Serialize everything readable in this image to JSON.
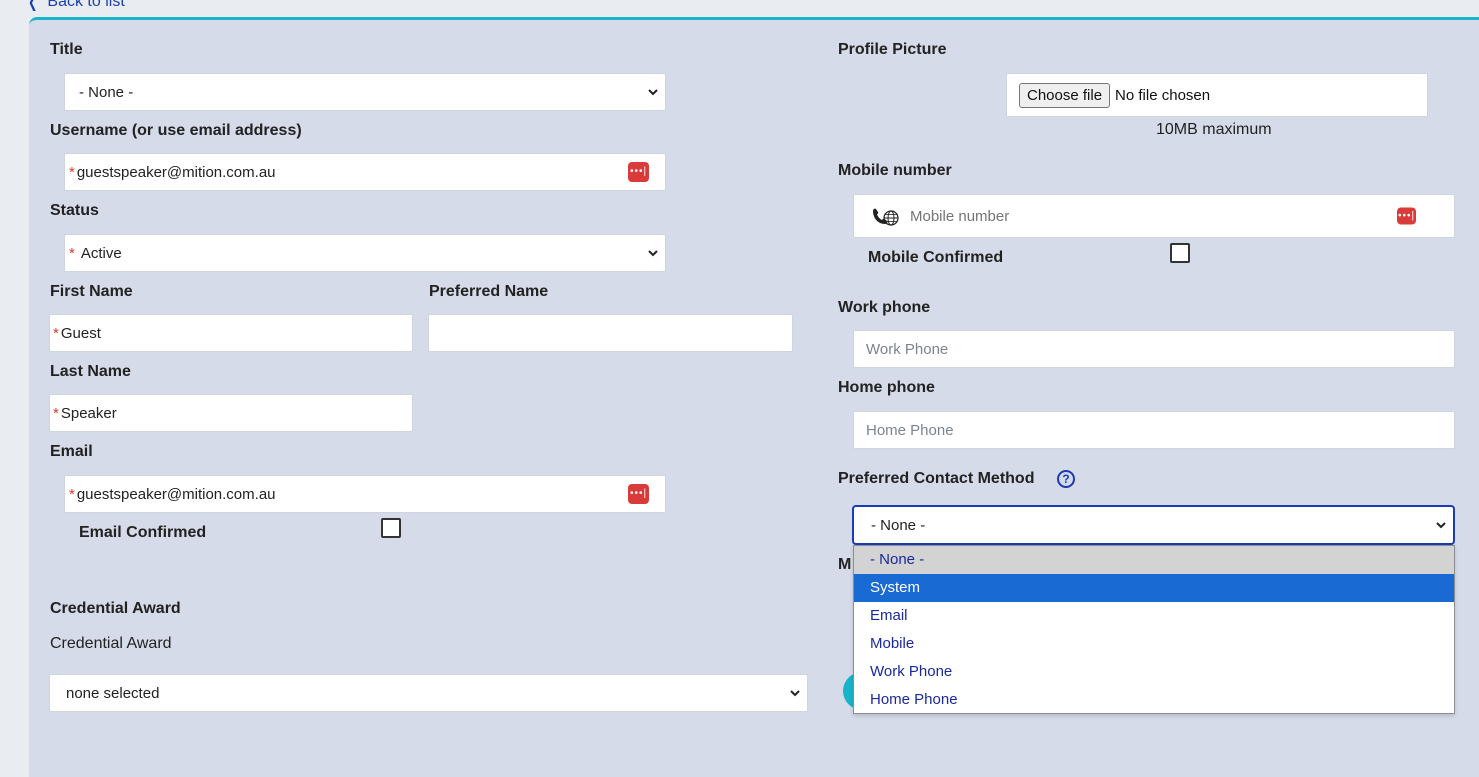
{
  "back_link": "Back to list",
  "left": {
    "title": {
      "label": "Title",
      "value": "- None -"
    },
    "username": {
      "label": "Username (or use email address)",
      "value": "guestspeaker@mition.com.au"
    },
    "status": {
      "label": "Status",
      "value": "Active"
    },
    "first_name": {
      "label": "First Name",
      "value": "Guest"
    },
    "preferred_name": {
      "label": "Preferred Name",
      "value": ""
    },
    "last_name": {
      "label": "Last Name",
      "value": "Speaker"
    },
    "email": {
      "label": "Email",
      "value": "guestspeaker@mition.com.au"
    },
    "email_confirmed": {
      "label": "Email Confirmed",
      "checked": false
    },
    "credential_award": {
      "section_label": "Credential Award",
      "label": "Credential Award",
      "value": "none selected"
    }
  },
  "right": {
    "profile_picture": {
      "label": "Profile Picture",
      "button": "Choose file",
      "status": "No file chosen",
      "hint": "10MB maximum"
    },
    "mobile": {
      "label": "Mobile number",
      "placeholder": "Mobile number"
    },
    "mobile_confirmed": {
      "label": "Mobile Confirmed",
      "checked": false
    },
    "work_phone": {
      "label": "Work phone",
      "placeholder": "Work Phone"
    },
    "home_phone": {
      "label": "Home phone",
      "placeholder": "Home Phone"
    },
    "preferred_contact": {
      "label": "Preferred Contact Method",
      "help": "?",
      "value": "- None -",
      "options": [
        "- None -",
        "System",
        "Email",
        "Mobile",
        "Work Phone",
        "Home Phone"
      ],
      "hovered": "- None -",
      "selected": "System"
    },
    "partial_label": "M"
  },
  "icons": {
    "password_manager": "password-manager-icon",
    "phone_globe": "phone-globe-icon",
    "caret": "chevron-down-icon",
    "help": "help-circle-icon"
  },
  "colors": {
    "accent": "#19b4c9",
    "required": "#d93a2b",
    "link": "#1c3fae",
    "selected": "#1a6ad3"
  }
}
